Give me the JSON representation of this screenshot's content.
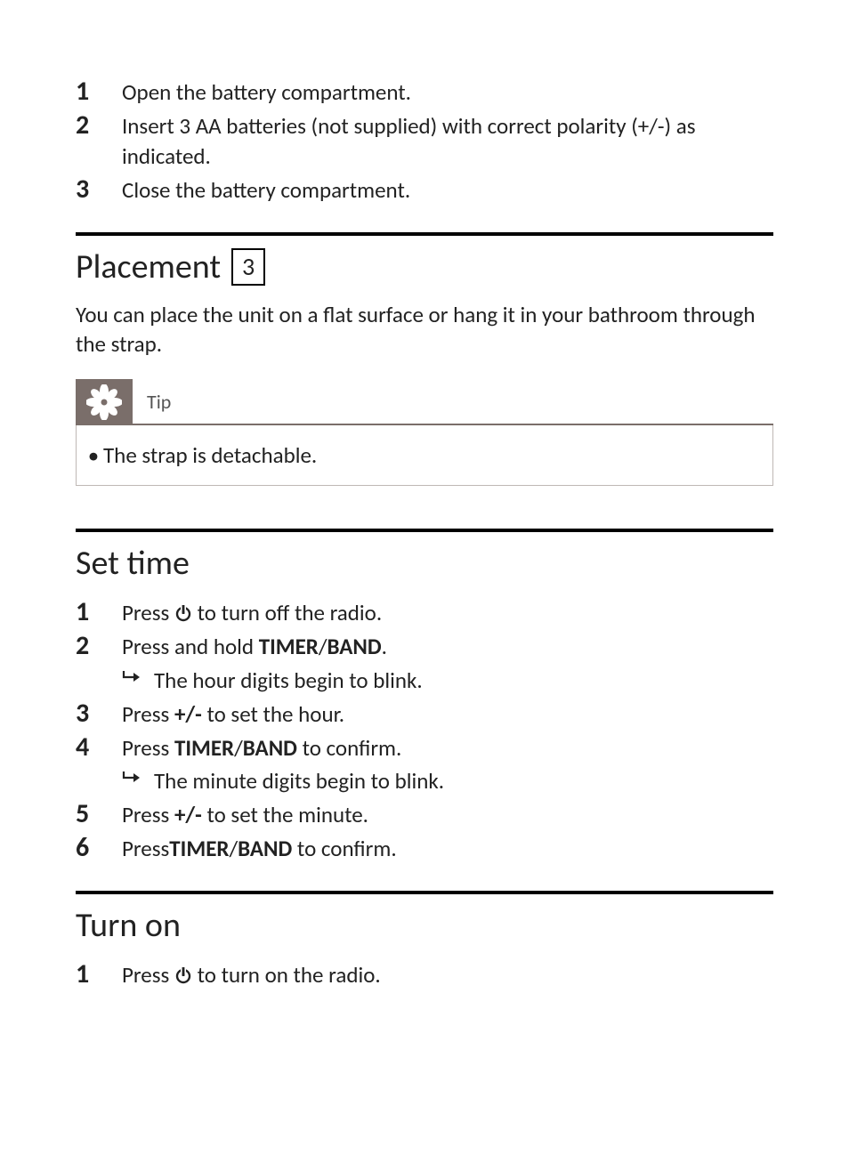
{
  "battery_steps": {
    "s1": {
      "num": "1",
      "text": "Open the battery compartment."
    },
    "s2": {
      "num": "2",
      "text": "Insert 3 AA batteries (not supplied) with correct polarity (+/-) as indicated."
    },
    "s3": {
      "num": "3",
      "text": "Close the battery compartment."
    }
  },
  "placement": {
    "heading": "Placement",
    "boxnum": "3",
    "para": "You can place the unit on a flat surface or hang it in your bathroom through the strap."
  },
  "tip": {
    "label": "Tip",
    "bullet_dot": "•",
    "bullet_text": "The strap is detachable."
  },
  "settime": {
    "heading": "Set time",
    "s1": {
      "num": "1",
      "pre": "Press ",
      "post": " to turn off the radio."
    },
    "s2": {
      "num": "2",
      "t1": "Press and hold ",
      "b1": "TIMER",
      "slash": "/",
      "b2": "BAND",
      "t2": ".",
      "sub": "The hour digits begin to blink."
    },
    "s3": {
      "num": "3",
      "t1": "Press ",
      "b1": "+/-",
      "t2": " to set the hour."
    },
    "s4": {
      "num": "4",
      "t1": "Press ",
      "b1": "TIMER",
      "slash": "/",
      "b2": "BAND",
      "t2": " to confirm.",
      "sub": "The minute digits begin to blink."
    },
    "s5": {
      "num": "5",
      "t1": "Press ",
      "b1": "+/-",
      "t2": " to set the minute."
    },
    "s6": {
      "num": "6",
      "t1": "Press",
      "b1": "TIMER",
      "slash": "/",
      "b2": "BAND",
      "t2": " to confirm."
    }
  },
  "turnon": {
    "heading": "Turn on",
    "s1": {
      "num": "1",
      "pre": "Press ",
      "post": " to turn on the radio."
    }
  }
}
